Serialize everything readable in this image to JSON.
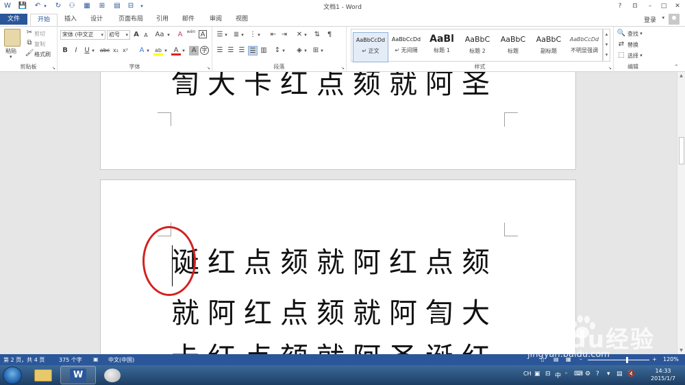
{
  "window": {
    "title": "文档1 - Word",
    "help": "?",
    "min": "–",
    "max": "□",
    "close": "✕"
  },
  "tabs": [
    {
      "label": "文件"
    },
    {
      "label": "开始"
    },
    {
      "label": "插入"
    },
    {
      "label": "设计"
    },
    {
      "label": "页面布局"
    },
    {
      "label": "引用"
    },
    {
      "label": "邮件"
    },
    {
      "label": "审阅"
    },
    {
      "label": "视图"
    }
  ],
  "account": {
    "login": "登录"
  },
  "clipboard": {
    "paste": "粘贴",
    "cut": "剪切",
    "copy": "复制",
    "format_painter": "格式刷",
    "label": "剪贴板"
  },
  "font": {
    "name": "宋体 (中文正",
    "size": "初号",
    "label": "字体",
    "bold": "B",
    "italic": "I",
    "underline": "U",
    "strike": "abc",
    "subscript": "x₂",
    "superscript": "x²",
    "case": "Aa",
    "grow": "A",
    "shrink": "A",
    "phonetic": "wén",
    "char_border": "A",
    "clear": "A",
    "highlight": "ab",
    "color": "A",
    "shading": "A",
    "circled": "字"
  },
  "paragraph": {
    "label": "段落"
  },
  "styles": {
    "label": "样式",
    "items": [
      {
        "sample": "AaBbCcDd",
        "name": "↵ 正文"
      },
      {
        "sample": "AaBbCcDd",
        "name": "↵ 无间隔"
      },
      {
        "sample": "AaBl",
        "name": "标题 1"
      },
      {
        "sample": "AaBbC",
        "name": "标题 2"
      },
      {
        "sample": "AaBbC",
        "name": "标题"
      },
      {
        "sample": "AaBbC",
        "name": "副标题"
      },
      {
        "sample": "AaBbCcDd",
        "name": "不明显强调"
      }
    ]
  },
  "editing": {
    "find": "查找",
    "replace": "替换",
    "select": "选择",
    "label": "编辑"
  },
  "document": {
    "page1_line": "訇大卡红点颏就阿圣",
    "page2_lines": [
      "诞红点颏就阿红点颏",
      "就阿红点颏就阿訇大",
      "卡红点颏就阿圣诞红"
    ]
  },
  "status": {
    "page": "第 2 页，共 4 页",
    "words": "375 个字",
    "language": "中文(中国)",
    "zoom": "120%"
  },
  "taskbar": {
    "ime": "CH",
    "ime_zh": "中",
    "time": "14:33",
    "date": "2015/1/7"
  },
  "watermark": {
    "logo": "Baidu经验",
    "url": "jingyan.baidu.com"
  },
  "colors": {
    "accent": "#2b579a",
    "annotation": "#d42020"
  }
}
